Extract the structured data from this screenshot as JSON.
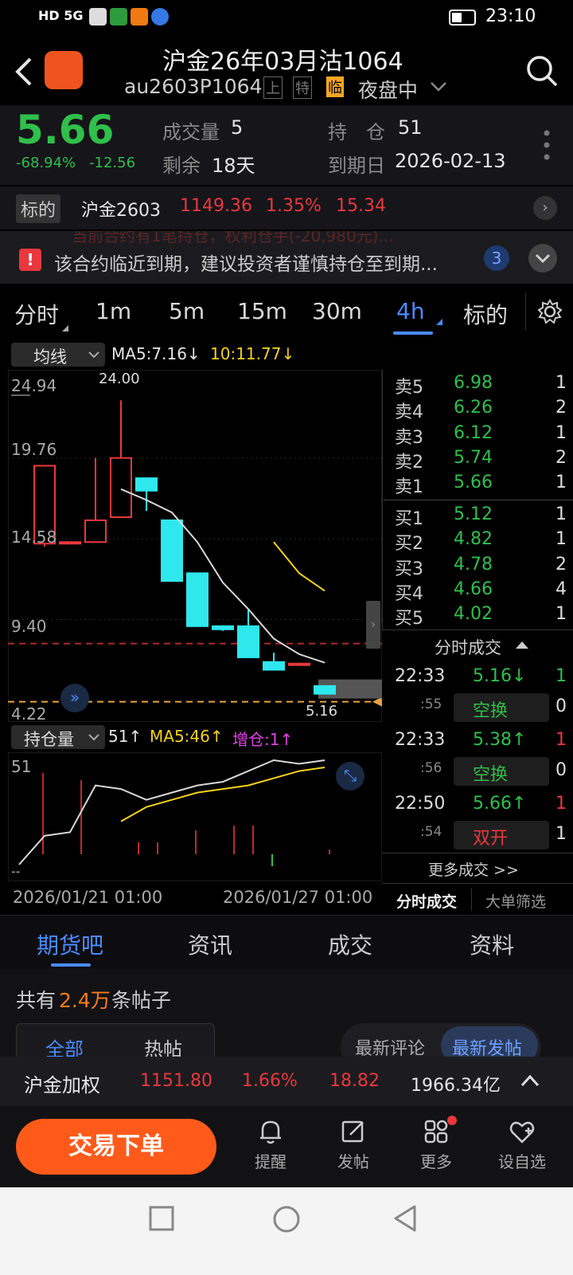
{
  "status_bar": {
    "left_icons": "HD 5G",
    "time": "23:10"
  },
  "header": {
    "title": "沪金26年03月沽1064",
    "code": "au2603P1064",
    "tags": [
      "上",
      "特",
      "临"
    ],
    "session": "夜盘中"
  },
  "quote": {
    "price": "5.66",
    "change_pct": "-68.94%",
    "change": "-12.56",
    "volume_label": "成交量",
    "volume": "5",
    "position_label": "持　仓",
    "position": "51",
    "remaining_label": "剩余",
    "remaining": "18天",
    "expiry_label": "到期日",
    "expiry": "2026-02-13"
  },
  "underlying": {
    "label": "标的",
    "name": "沪金2603",
    "price": "1149.36",
    "pct": "1.35%",
    "change": "15.34"
  },
  "notice": {
    "hidden_text": "当前合约有1笔持仓，权利仓手(-20,980元)...",
    "text": "该合约临近到期，建议投资者谨慎持仓至到期...",
    "count": "3"
  },
  "period_tabs": [
    "分时",
    "1m",
    "5m",
    "15m",
    "30m",
    "4h",
    "标的"
  ],
  "active_tab": "4h",
  "indicator": {
    "name": "均线",
    "ma5": "MA5:7.16↓",
    "ma10": "10:11.77↓"
  },
  "chart_data": {
    "type": "candlestick",
    "price_axis_labels": [
      "24.94",
      "19.76",
      "14.58",
      "9.40",
      "4.22"
    ],
    "high_label": "24.00",
    "last_label": "5.16",
    "ylim": [
      4.22,
      24.94
    ],
    "candles": [
      {
        "o": 14.8,
        "h": 19.8,
        "l": 14.6,
        "c": 19.8
      },
      {
        "o": 14.9,
        "h": 14.9,
        "l": 14.9,
        "c": 14.9
      },
      {
        "o": 14.9,
        "h": 20.3,
        "l": 14.9,
        "c": 16.3
      },
      {
        "o": 16.5,
        "h": 24.0,
        "l": 16.5,
        "c": 20.3
      },
      {
        "o": 19.0,
        "h": 19.0,
        "l": 16.9,
        "c": 18.2
      },
      {
        "o": 16.3,
        "h": 16.3,
        "l": 12.4,
        "c": 12.4
      },
      {
        "o": 12.9,
        "h": 12.9,
        "l": 9.5,
        "c": 9.5
      },
      {
        "o": 9.5,
        "h": 9.5,
        "l": 9.2,
        "c": 9.3
      },
      {
        "o": 9.5,
        "h": 10.6,
        "l": 7.5,
        "c": 7.5
      },
      {
        "o": 7.2,
        "h": 7.8,
        "l": 6.7,
        "c": 6.7
      },
      {
        "o": 7.1,
        "h": 7.1,
        "l": 7.1,
        "c": 7.1
      },
      {
        "o": 5.66,
        "h": 5.66,
        "l": 5.16,
        "c": 5.16
      }
    ],
    "ma5": [
      null,
      null,
      null,
      18.3,
      17.6,
      16.8,
      14.9,
      12.3,
      10.6,
      8.7,
      7.7,
      7.16
    ],
    "ma10": [
      null,
      null,
      null,
      null,
      null,
      null,
      null,
      null,
      null,
      14.9,
      12.9,
      11.77
    ],
    "ref_lines": {
      "prev_settle": 9.0,
      "last": 5.16
    }
  },
  "order_book": {
    "asks": [
      {
        "label": "卖5",
        "price": "6.98",
        "qty": "1"
      },
      {
        "label": "卖4",
        "price": "6.26",
        "qty": "2"
      },
      {
        "label": "卖3",
        "price": "6.12",
        "qty": "1"
      },
      {
        "label": "卖2",
        "price": "5.74",
        "qty": "2"
      },
      {
        "label": "卖1",
        "price": "5.66",
        "qty": "1"
      }
    ],
    "bids": [
      {
        "label": "买1",
        "price": "5.12",
        "qty": "1"
      },
      {
        "label": "买2",
        "price": "4.82",
        "qty": "1"
      },
      {
        "label": "买3",
        "price": "4.78",
        "qty": "2"
      },
      {
        "label": "买4",
        "price": "4.66",
        "qty": "4"
      },
      {
        "label": "买5",
        "price": "4.02",
        "qty": "1"
      }
    ]
  },
  "trades": {
    "title": "分时成交",
    "rows": [
      {
        "time": "22:33",
        "price": "5.16↓",
        "qty": "1",
        "sec": ":55",
        "type": "空换",
        "type_qty": "0"
      },
      {
        "time": "22:33",
        "price": "5.38↑",
        "qty": "1",
        "sec": ":56",
        "type": "空换",
        "type_qty": "0"
      },
      {
        "time": "22:50",
        "price": "5.66↑",
        "qty": "1",
        "sec": ":54",
        "type": "双开",
        "type_qty": "1"
      }
    ],
    "more": "更多成交 >>",
    "tab1": "分时成交",
    "tab2": "大单筛选"
  },
  "oi_indicator": {
    "name": "持仓量",
    "value": "51↑",
    "ma5": "MA5:46↑",
    "add": "增仓:1↑",
    "axis_top": "51",
    "axis_bottom": "--"
  },
  "oi_data": {
    "oi": [
      22,
      30,
      31,
      44,
      43,
      40,
      42,
      44,
      45,
      48,
      51,
      50,
      51
    ],
    "ma5": [
      null,
      null,
      null,
      null,
      34,
      38,
      40,
      42,
      43,
      44,
      46,
      48,
      49
    ],
    "bars": [
      0,
      34,
      0,
      31,
      0,
      0,
      5,
      5,
      0,
      10,
      0,
      12,
      12,
      -5,
      0,
      0,
      2,
      0
    ]
  },
  "date_axis": [
    "2026/01/21 01:00",
    "2026/01/27 01:00"
  ],
  "section_tabs": [
    "期货吧",
    "资讯",
    "成交",
    "资料"
  ],
  "forum": {
    "prefix": "共有",
    "count": "2.4万",
    "suffix": "条帖子",
    "sub_tabs": [
      "全部",
      "热帖"
    ],
    "sort_tabs": [
      "最新评论",
      "最新发帖"
    ]
  },
  "ticker": {
    "name": "沪金加权",
    "price": "1151.80",
    "pct": "1.66%",
    "change": "18.82",
    "amount": "1966.34亿"
  },
  "bottom_bar": {
    "trade": "交易下单",
    "items": [
      "提醒",
      "发帖",
      "更多",
      "设自选"
    ]
  },
  "colors": {
    "up": "#e8383d",
    "down_candle": "#2ee8ee",
    "accent": "#4a8cff",
    "trade_button": "#ff5a1a"
  }
}
